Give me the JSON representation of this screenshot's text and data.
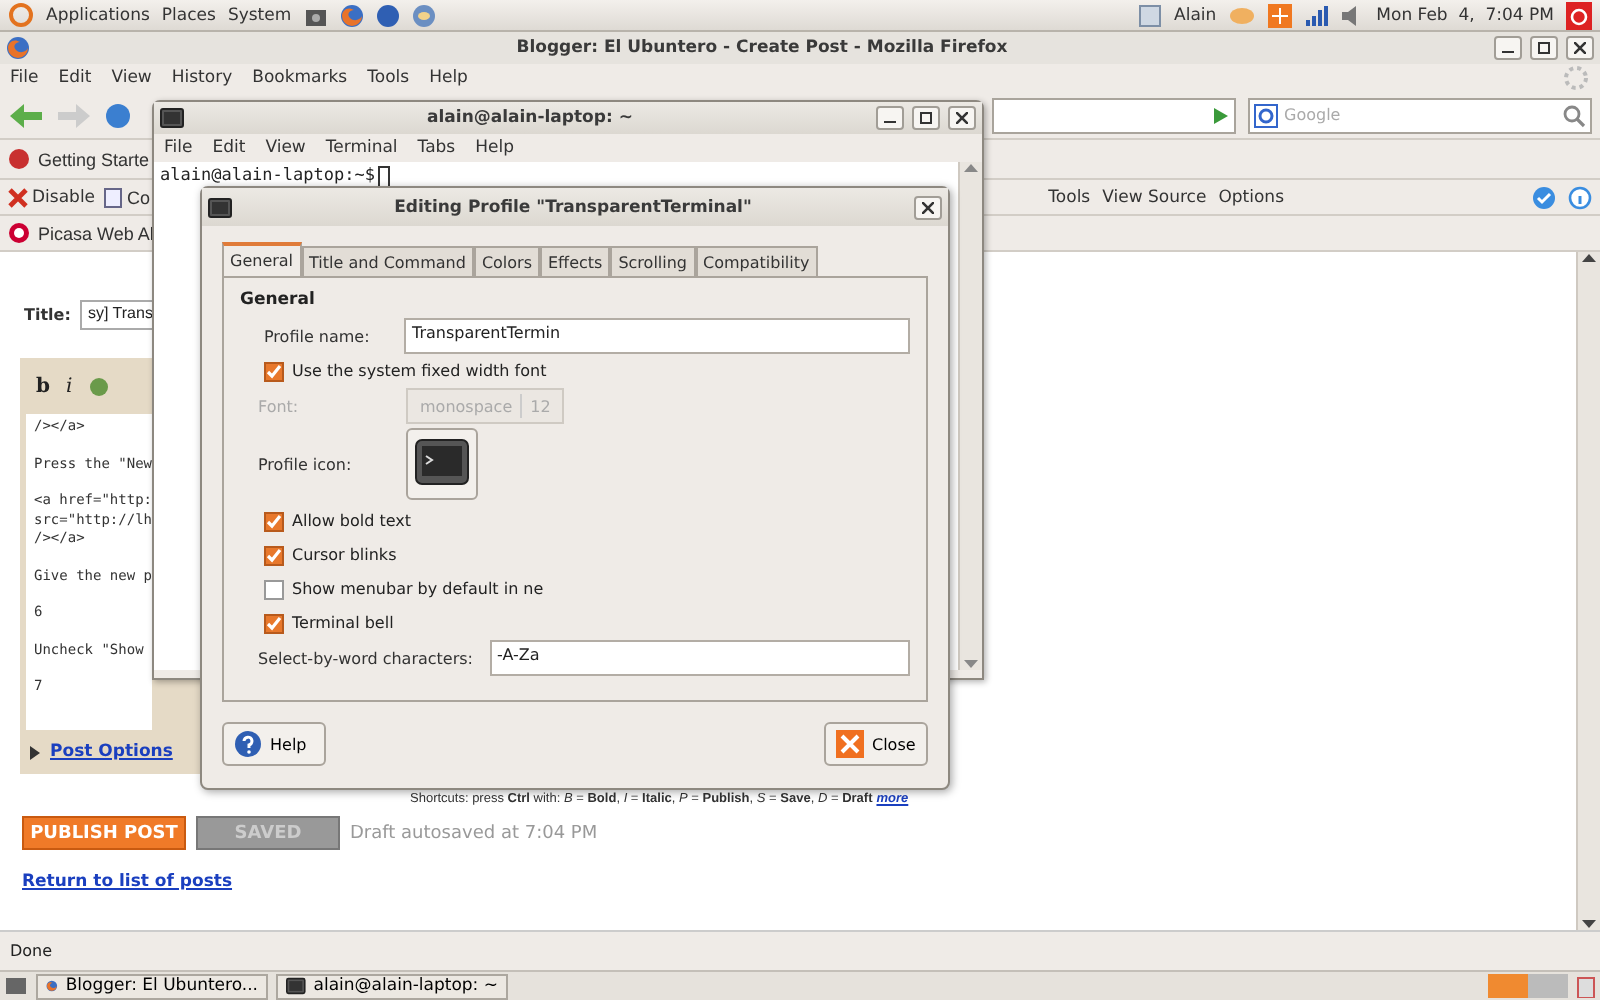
{
  "top_panel": {
    "menus": [
      "Applications",
      "Places",
      "System"
    ],
    "user": "Alain",
    "clock": "Mon Feb  4,  7:04 PM"
  },
  "firefox": {
    "title": "Blogger: El Ubuntero - Create Post - Mozilla Firefox",
    "menu": [
      "File",
      "Edit",
      "View",
      "History",
      "Bookmarks",
      "Tools",
      "Help"
    ],
    "search_placeholder": "Google",
    "bookmarks": [
      "Getting Starte"
    ],
    "dev_left": [
      "Disable",
      "Co"
    ],
    "dev_right": [
      "Tools",
      "View Source",
      "Options"
    ],
    "tab": "Picasa Web Al",
    "status": "Done"
  },
  "blogger": {
    "title_label": "Title:",
    "title_value": "sy] Trans",
    "editor_tools": [
      "b",
      "i"
    ],
    "editor_paragraphs": [
      "/></a>",
      "Press the \"New",
      "<a href=\"http:\nsrc=\"http://lh\n/></a>",
      "Give the new p",
      "6",
      "Uncheck \"Show",
      "7"
    ],
    "post_options": "Post Options",
    "shortcuts": "Shortcuts: press **Ctrl** with: *B* = **Bold**, *I* = **Italic**, *P* = **Publish**, *S* = **Save**, *D* = **Draft**",
    "more": "more",
    "publish": "PUBLISH POST",
    "saved": "SAVED",
    "autosave": "Draft autosaved at 7:04 PM",
    "return_link": "Return to list of posts"
  },
  "terminal": {
    "title": "alain@alain-laptop: ~",
    "menu": [
      "File",
      "Edit",
      "View",
      "Terminal",
      "Tabs",
      "Help"
    ],
    "prompt": "alain@alain-laptop:~$"
  },
  "dialog": {
    "title": "Editing Profile \"TransparentTerminal\"",
    "tabs": [
      {
        "label": "General",
        "selected": true
      },
      {
        "label": "Title and Command",
        "selected": false
      },
      {
        "label": "Colors",
        "selected": false
      },
      {
        "label": "Effects",
        "selected": false
      },
      {
        "label": "Scrolling",
        "selected": false
      },
      {
        "label": "Compatibility",
        "selected": false
      }
    ],
    "section": "General",
    "profile_name_label": "Profile name:",
    "profile_name": "TransparentTermin",
    "system_font": {
      "label": "Use the system fixed width font",
      "checked": true
    },
    "font": {
      "label": "Font:",
      "family": "monospace",
      "size": "12",
      "disabled": true
    },
    "icon_label": "Profile icon:",
    "options": [
      {
        "label": "Allow bold text",
        "checked": true
      },
      {
        "label": "Cursor blinks",
        "checked": true
      },
      {
        "label": "Show menubar by default in ne",
        "checked": false
      },
      {
        "label": "Terminal bell",
        "checked": true
      }
    ],
    "word_chars_label": "Select-by-word characters:",
    "word_chars": "-A-Za",
    "help": "Help",
    "close": "Close"
  },
  "taskbar": {
    "browser": "Blogger: El Ubuntero...",
    "terminal": "alain@alain-laptop: ~"
  }
}
